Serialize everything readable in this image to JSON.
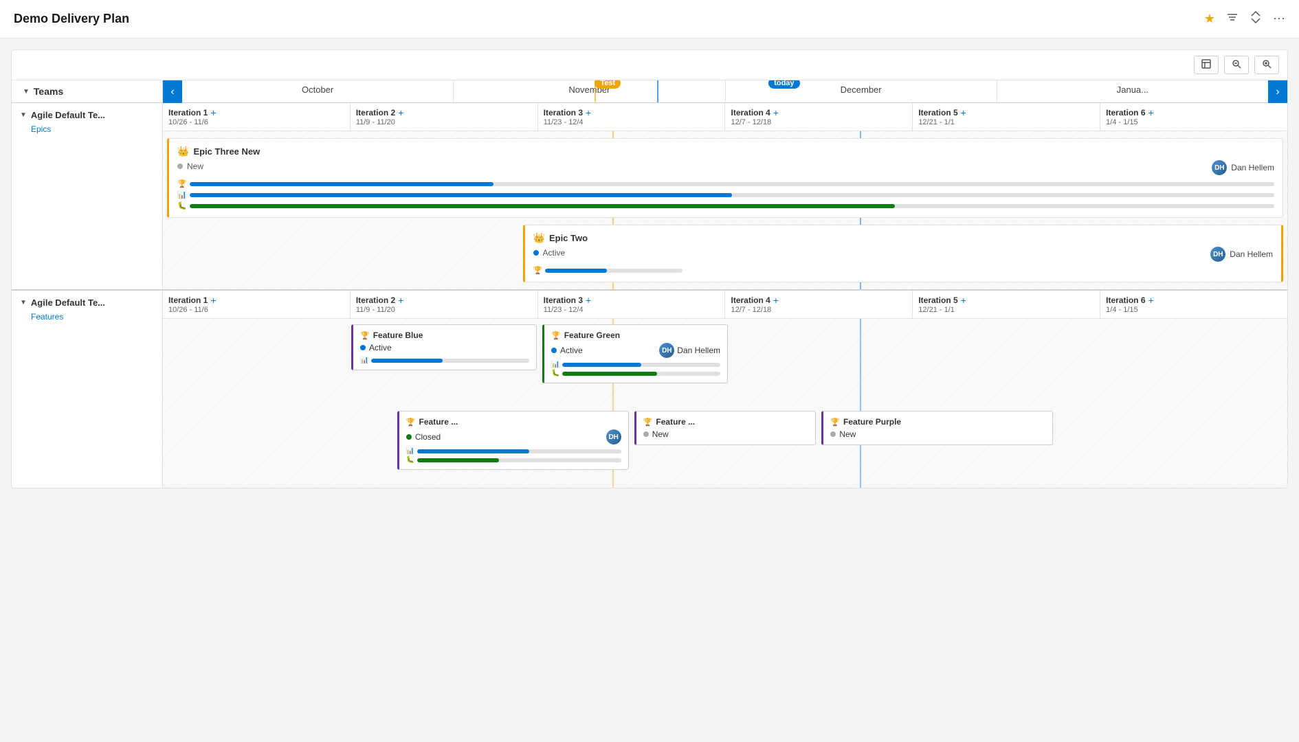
{
  "header": {
    "title": "Demo Delivery Plan",
    "actions": {
      "star": "★",
      "filter": "⚡",
      "collapse": "⤢",
      "more": "⋯"
    }
  },
  "toolbar": {
    "fit_icon": "▣",
    "zoom_out": "−",
    "zoom_in": "+"
  },
  "timeline": {
    "nav_prev": "‹",
    "nav_next": "›",
    "months": [
      "October",
      "November",
      "December",
      "Janua..."
    ],
    "badge_test": "Test",
    "badge_today": "today",
    "teams_label": "Teams"
  },
  "team1": {
    "name": "Agile Default Te...",
    "sub_label": "Epics",
    "iterations": [
      {
        "name": "Iteration 1",
        "dates": "10/26 - 11/6"
      },
      {
        "name": "Iteration 2",
        "dates": "11/9 - 11/20"
      },
      {
        "name": "Iteration 3",
        "dates": "11/23 - 12/4"
      },
      {
        "name": "Iteration 4",
        "dates": "12/7 - 12/18"
      },
      {
        "name": "Iteration 5",
        "dates": "12/21 - 1/1"
      },
      {
        "name": "Iteration 6",
        "dates": "1/4 - 1/15"
      }
    ],
    "epics": [
      {
        "id": "epic3",
        "title": "Epic Three New",
        "status": "New",
        "status_type": "new",
        "assignee": "Dan Hellem",
        "bars": [
          {
            "type": "trophy",
            "fill_pct": 30,
            "color": "blue"
          },
          {
            "type": "stack",
            "fill_pct": 55,
            "color": "blue"
          },
          {
            "type": "bug",
            "fill_pct": 70,
            "color": "green"
          }
        ]
      },
      {
        "id": "epic2",
        "title": "Epic Two",
        "status": "Active",
        "status_type": "active",
        "assignee": "Dan Hellem",
        "bars": [
          {
            "type": "trophy",
            "fill_pct": 45,
            "color": "blue"
          }
        ]
      }
    ]
  },
  "team2": {
    "name": "Agile Default Te...",
    "sub_label": "Features",
    "iterations": [
      {
        "name": "Iteration 1",
        "dates": "10/26 - 11/6"
      },
      {
        "name": "Iteration 2",
        "dates": "11/9 - 11/20"
      },
      {
        "name": "Iteration 3",
        "dates": "11/23 - 12/4"
      },
      {
        "name": "Iteration 4",
        "dates": "12/7 - 12/18"
      },
      {
        "name": "Iteration 5",
        "dates": "12/21 - 1/1"
      },
      {
        "name": "Iteration 6",
        "dates": "1/4 - 1/15"
      }
    ],
    "features_row1": [
      {
        "id": "feat_blue",
        "title": "Feature Blue",
        "status": "Active",
        "status_type": "active",
        "assignee": null,
        "border": "purple",
        "bars": [
          {
            "type": "stack",
            "fill_pct": 45,
            "color": "blue"
          }
        ],
        "col": 1
      },
      {
        "id": "feat_green",
        "title": "Feature Green",
        "status": "Active",
        "status_type": "active",
        "assignee": "Dan Hellem",
        "border": "green",
        "bars": [
          {
            "type": "stack",
            "fill_pct": 50,
            "color": "blue"
          },
          {
            "type": "bug",
            "fill_pct": 60,
            "color": "green"
          }
        ],
        "col": 2
      }
    ],
    "features_row2": [
      {
        "id": "feat_closed",
        "title": "Feature ...",
        "status": "Closed",
        "status_type": "closed",
        "assignee_avatar": true,
        "border": "purple",
        "bars": [
          {
            "type": "stack",
            "fill_pct": 55,
            "color": "blue"
          },
          {
            "type": "bug",
            "fill_pct": 40,
            "color": "green"
          }
        ],
        "col": 1
      },
      {
        "id": "feat_new1",
        "title": "Feature ...",
        "status": "New",
        "status_type": "new",
        "border": "purple",
        "col": 2
      },
      {
        "id": "feat_purple",
        "title": "Feature Purple",
        "status": "New",
        "status_type": "new",
        "border": "purple",
        "col": 3
      }
    ]
  }
}
